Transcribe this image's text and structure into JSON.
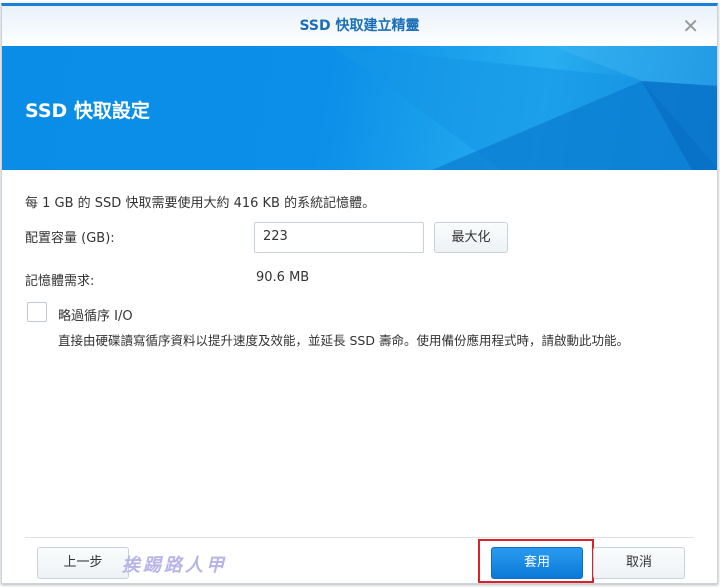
{
  "window": {
    "title": "SSD 快取建立精靈",
    "close": "✕"
  },
  "banner": {
    "title": "SSD 快取設定"
  },
  "info": "每 1 GB 的 SSD 快取需要使用大約 416 KB 的系統記憶體。",
  "capacity": {
    "label": "配置容量 (GB):",
    "value": "223",
    "max_button": "最大化"
  },
  "memory": {
    "label": "記憶體需求:",
    "value": "90.6 MB"
  },
  "skip_seq": {
    "label": "略過循序 I/O",
    "desc": "直接由硬碟讀寫循序資料以提升速度及效能，並延長 SSD 壽命。使用備份應用程式時，請啟動此功能。",
    "checked": false
  },
  "footer": {
    "back": "上一步",
    "apply": "套用",
    "cancel": "取消"
  },
  "watermark": "挨踢路人甲"
}
